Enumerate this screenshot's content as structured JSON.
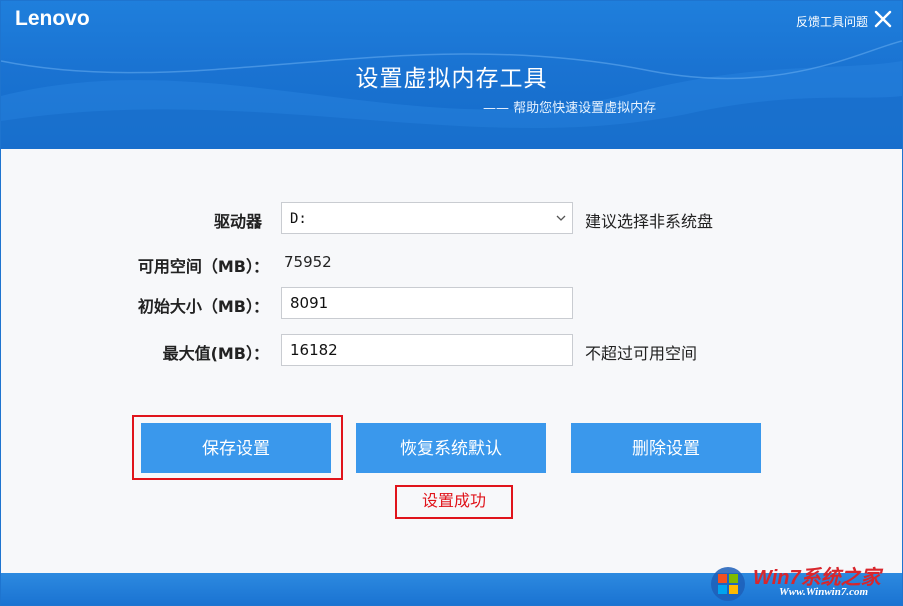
{
  "app": {
    "logo": "Lenovo",
    "feedback_label": "反馈工具问题",
    "title": "设置虚拟内存工具",
    "subtitle": "—— 帮助您快速设置虚拟内存"
  },
  "form": {
    "drive": {
      "label": "驱动器",
      "colon": "：",
      "value": "D:",
      "hint": "建议选择非系统盘"
    },
    "available": {
      "label": "可用空间（MB）",
      "colon": "：",
      "value": "75952"
    },
    "initial": {
      "label": "初始大小（MB）",
      "colon": "：",
      "value": "8091"
    },
    "maximum": {
      "label": "最大值(MB）",
      "colon": "：",
      "value": "16182",
      "hint": "不超过可用空间"
    }
  },
  "buttons": {
    "save": "保存设置",
    "restore": "恢复系统默认",
    "delete": "删除设置"
  },
  "status": {
    "message": "设置成功"
  },
  "watermark": {
    "text": "Win7系统之家",
    "url": "Www.Winwin7.com"
  },
  "colors": {
    "accent": "#3a98ec",
    "header": "#1a73d2",
    "highlight": "#e0141b"
  }
}
